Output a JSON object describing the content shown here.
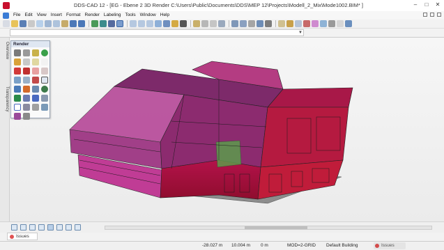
{
  "window": {
    "title": "DDS-CAD 12 - [EG - Ebene 2  3D  Render  C:\\Users\\Public\\Documents\\DDS\\MEP 12\\Projects\\Modell_2_Mix\\Mode1002.BIM* ]"
  },
  "menu": {
    "items": [
      "File",
      "Edit",
      "View",
      "Insert",
      "Format",
      "Render",
      "Labeling",
      "Tools",
      "Window",
      "Help"
    ]
  },
  "left_tabs": {
    "overview": "Overview",
    "transparency": "Transparency"
  },
  "palette": {
    "title": "Render"
  },
  "bottom": {
    "issues_tab": "Issues"
  },
  "status": {
    "x": "-28.027 m",
    "y": "10.004 m",
    "z": "0 m",
    "mode": "MOD=2-GRID",
    "building": "Default Building",
    "issues": "Issues"
  },
  "colors": {
    "accent": "#c8102e",
    "building_red": "#c0123a",
    "building_purple": "#8a2a7a",
    "building_magenta": "#d04a9e"
  }
}
